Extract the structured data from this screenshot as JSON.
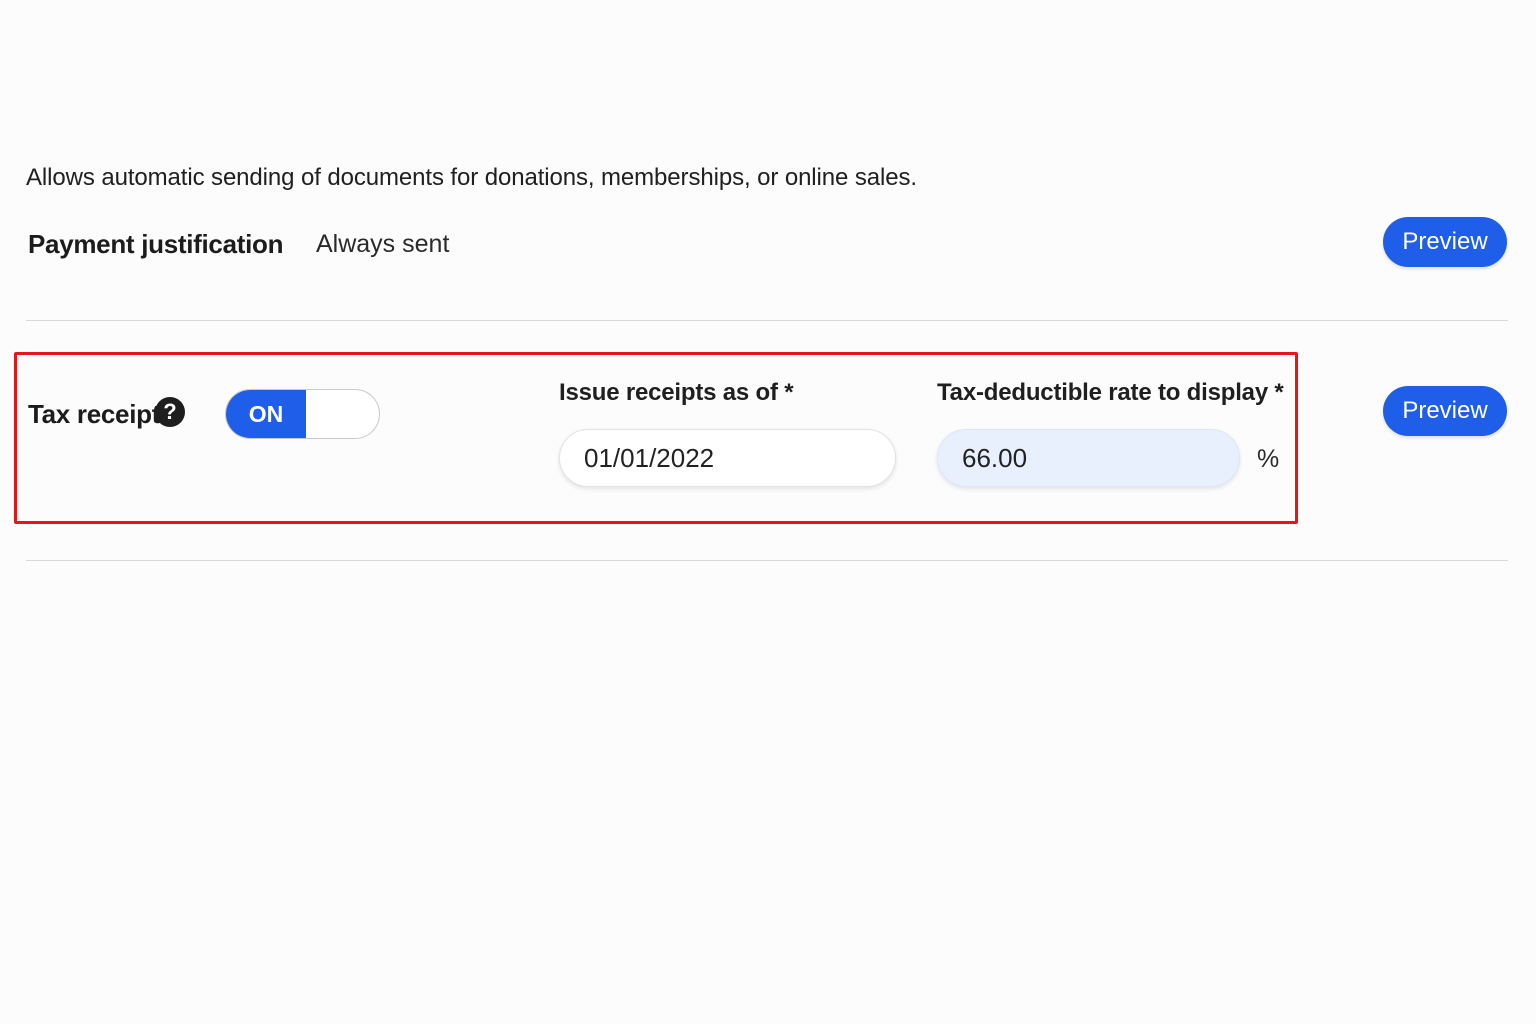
{
  "description": "Allows automatic sending of documents for donations, memberships, or online sales.",
  "payment_justification": {
    "label": "Payment justification",
    "status": "Always sent",
    "preview_label": "Preview"
  },
  "tax_receipt": {
    "label": "Tax receipt",
    "help_icon": "question-circle-icon",
    "help_glyph": "?",
    "toggle_label": "ON",
    "toggle_state": "on",
    "issue_date": {
      "label": "Issue receipts as of *",
      "value": "01/01/2022"
    },
    "rate": {
      "label": "Tax-deductible rate to display *",
      "value": "66.00",
      "unit": "%"
    },
    "preview_label": "Preview"
  },
  "colors": {
    "accent": "#1f5ee8",
    "highlight_border": "#e8141b",
    "rate_field_bg": "#e8f0fd",
    "divider": "#d9d9d9"
  }
}
